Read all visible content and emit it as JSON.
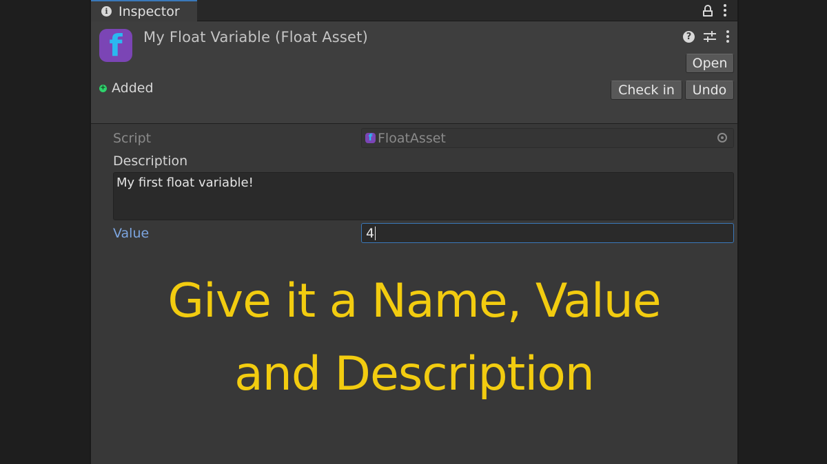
{
  "tab": {
    "label": "Inspector"
  },
  "header": {
    "title": "My Float Variable (Float Asset)",
    "icon_letter": "f",
    "open_label": "Open",
    "checkin_label": "Check in",
    "undo_label": "Undo",
    "vcs_status": "Added"
  },
  "fields": {
    "script_label": "Script",
    "script_value": "FloatAsset",
    "description_label": "Description",
    "description_value": "My first float variable!",
    "value_label": "Value",
    "value_value": "4"
  },
  "caption": {
    "line1": "Give it a Name, Value",
    "line2": "and Description"
  },
  "colors": {
    "accent": "#3a79bb",
    "caption": "#f2cc10",
    "icon_bg": "#7b45b5",
    "icon_fg": "#2bb8f0",
    "added": "#2ed36c"
  },
  "icons": [
    "info-icon",
    "lock-icon",
    "more-icon",
    "help-icon",
    "preset-icon",
    "added-icon",
    "object-picker-icon"
  ]
}
